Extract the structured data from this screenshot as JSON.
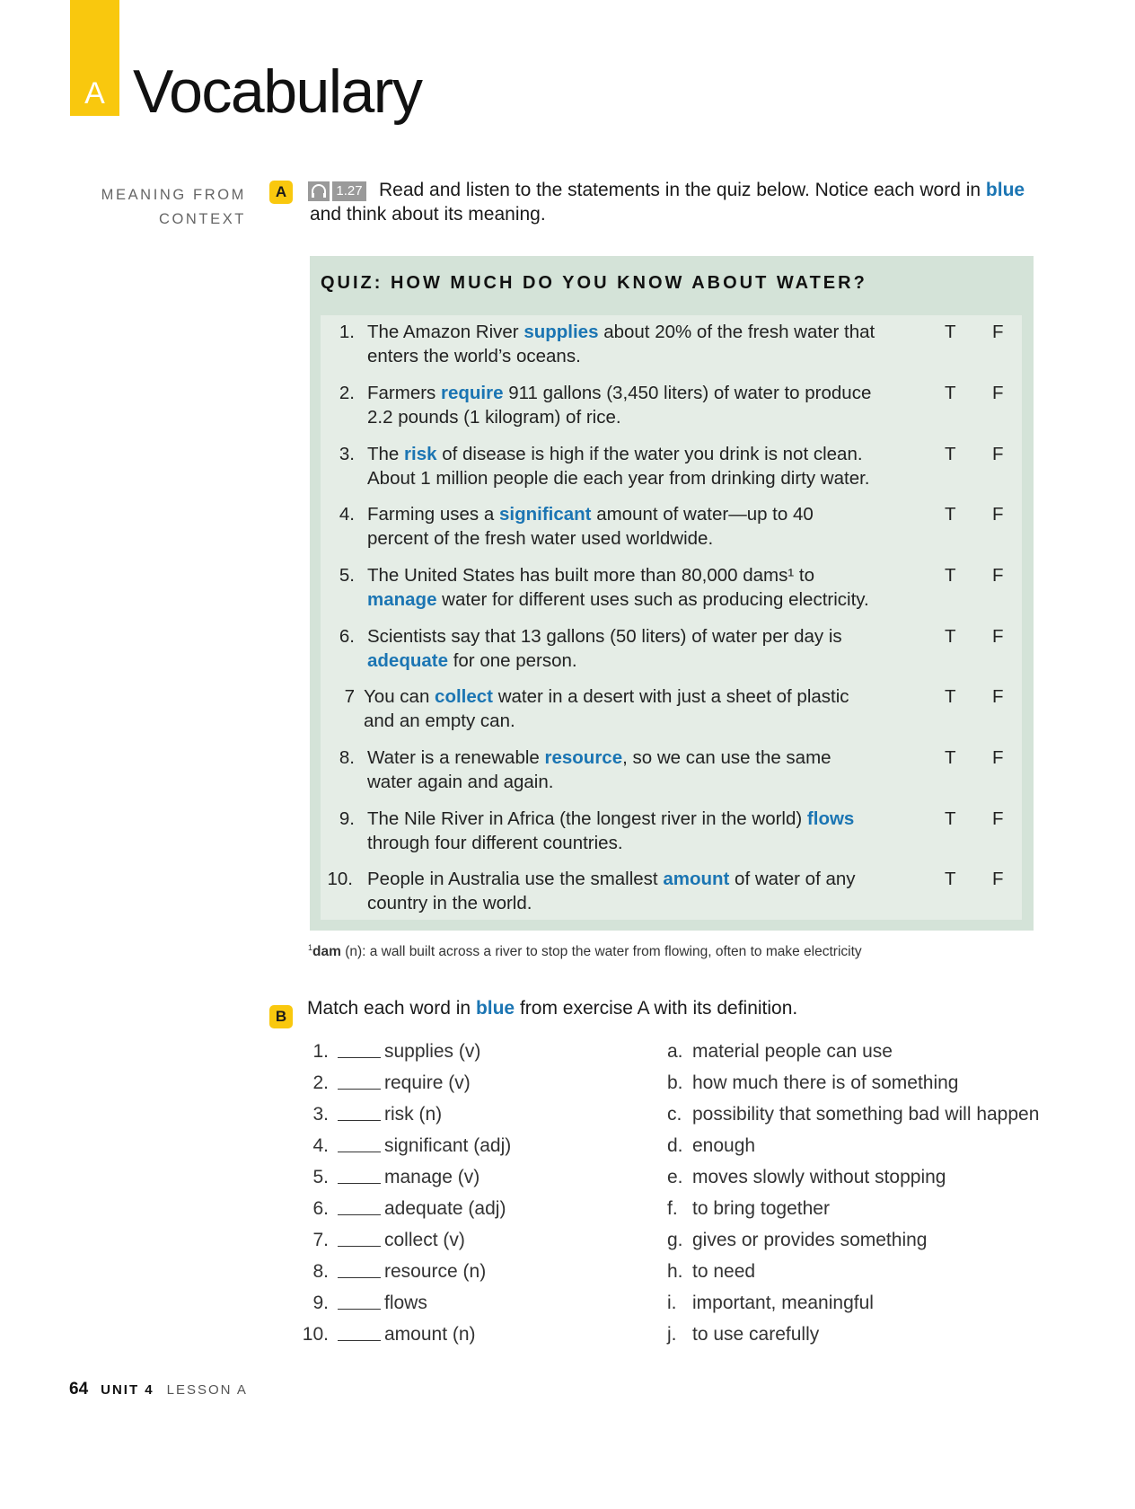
{
  "header": {
    "section_letter": "A",
    "title": "Vocabulary"
  },
  "side_label": {
    "line1": "MEANING FROM",
    "line2": "CONTEXT"
  },
  "exercise_a": {
    "badge": "A",
    "audio_track": "1.27",
    "audio_icon": "headphones-icon",
    "instruction_pre": "Read and listen to the statements in the quiz below. Notice each word in ",
    "instruction_blue": "blue",
    "instruction_post": " and think about its meaning."
  },
  "quiz": {
    "title": "QUIZ: HOW MUCH DO YOU KNOW ABOUT WATER?",
    "true_label": "T",
    "false_label": "F",
    "items": [
      {
        "num": "1.",
        "pre": "The Amazon River ",
        "word": "supplies",
        "post": " about 20% of the fresh water that enters the world’s oceans."
      },
      {
        "num": "2.",
        "pre": "Farmers ",
        "word": "require",
        "post": " 911 gallons (3,450 liters) of water to produce 2.2 pounds (1 kilogram) of rice."
      },
      {
        "num": "3.",
        "pre": "The ",
        "word": "risk",
        "post": " of disease is high if the water you drink is not clean. About 1 million people die each year from drinking dirty water."
      },
      {
        "num": "4.",
        "pre": "Farming uses a ",
        "word": "significant",
        "post": " amount of water—up to 40 percent of the fresh water used worldwide."
      },
      {
        "num": "5.",
        "pre": "The United States has built more than 80,000 dams¹ to ",
        "word": "manage",
        "post": " water for different uses such as producing electricity."
      },
      {
        "num": "6.",
        "pre": "Scientists say that 13 gallons (50 liters) of water per day is ",
        "word": "adequate",
        "post": " for one person."
      },
      {
        "num": "7",
        "pre": "You can ",
        "word": "collect",
        "post": " water in a desert with just a sheet of plastic and an empty can."
      },
      {
        "num": "8.",
        "pre": "Water is a renewable ",
        "word": "resource",
        "post": ", so we can use the same water again and again."
      },
      {
        "num": "9.",
        "pre": "The Nile River in Africa (the longest river in the world) ",
        "word": "flows",
        "post": " through four different countries."
      },
      {
        "num": "10.",
        "pre": "People in Australia use the smallest ",
        "word": "amount",
        "post": " of water of any country in the world."
      }
    ]
  },
  "footnote": {
    "marker": "1",
    "term": "dam",
    "text": " (n): a wall built across a river to stop the water from flowing, often to make electricity"
  },
  "exercise_b": {
    "badge": "B",
    "instruction_pre": "Match each word in ",
    "instruction_blue": "blue",
    "instruction_post": " from exercise A with its definition.",
    "words": [
      {
        "num": "1.",
        "word": "supplies (v)"
      },
      {
        "num": "2.",
        "word": "require (v)"
      },
      {
        "num": "3.",
        "word": "risk (n)"
      },
      {
        "num": "4.",
        "word": "significant (adj)"
      },
      {
        "num": "5.",
        "word": "manage (v)"
      },
      {
        "num": "6.",
        "word": "adequate (adj)"
      },
      {
        "num": "7.",
        "word": "collect (v)"
      },
      {
        "num": "8.",
        "word": "resource (n)"
      },
      {
        "num": "9.",
        "word": "flows"
      },
      {
        "num": "10.",
        "word": "amount (n)"
      }
    ],
    "definitions": [
      {
        "letter": "a.",
        "text": "material people can use"
      },
      {
        "letter": "b.",
        "text": "how much there is of something"
      },
      {
        "letter": "c.",
        "text": "possibility that something bad will happen"
      },
      {
        "letter": "d.",
        "text": "enough"
      },
      {
        "letter": "e.",
        "text": "moves slowly without stopping"
      },
      {
        "letter": "f.",
        "text": "to bring together"
      },
      {
        "letter": "g.",
        "text": "gives or provides something"
      },
      {
        "letter": "h.",
        "text": "to need"
      },
      {
        "letter": "i.",
        "text": "important, meaningful"
      },
      {
        "letter": "j.",
        "text": "to use carefully"
      }
    ]
  },
  "footer": {
    "page_number": "64",
    "unit": "UNIT 4",
    "lesson": "LESSON A"
  },
  "colors": {
    "accent_yellow": "#f9c80e",
    "vocab_blue": "#1b75b3",
    "quiz_outer_bg": "#d4e3d8",
    "quiz_inner_bg": "#e5ede6"
  }
}
